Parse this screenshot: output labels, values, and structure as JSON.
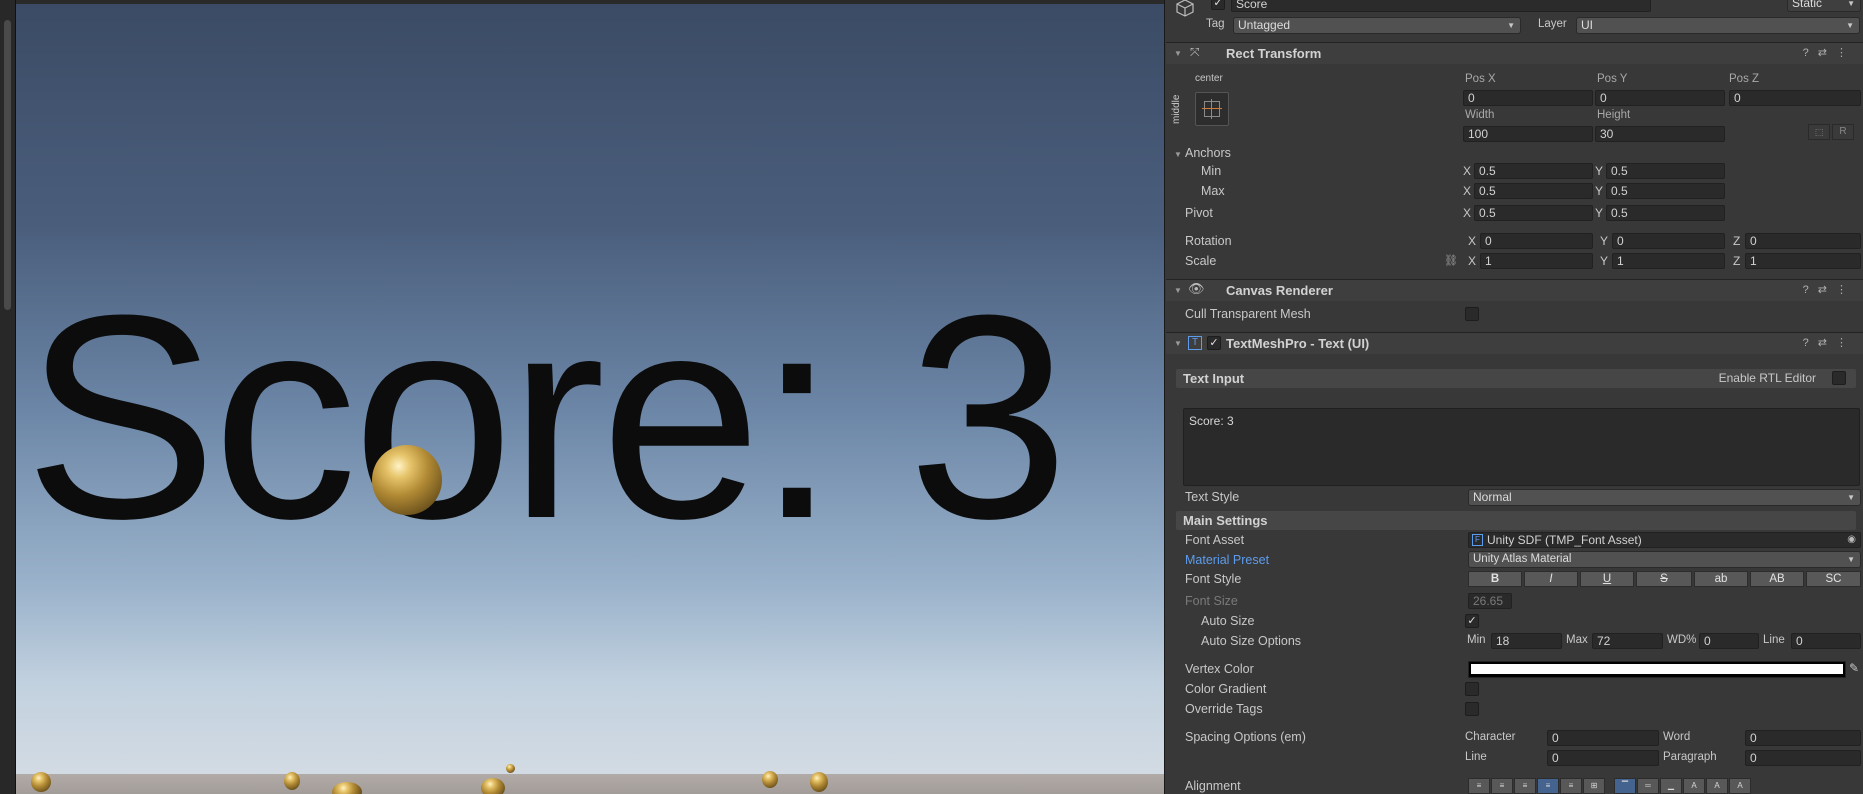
{
  "scene": {
    "score_text": "Score: 3"
  },
  "header": {
    "object_name": "Score",
    "active_checked": true,
    "static_label": "Static",
    "tag_label": "Tag",
    "tag_value": "Untagged",
    "layer_label": "Layer",
    "layer_value": "UI"
  },
  "rect_transform": {
    "title": "Rect Transform",
    "anchor_preset_h": "center",
    "anchor_preset_v": "middle",
    "pos_x_label": "Pos X",
    "pos_x": "0",
    "pos_y_label": "Pos Y",
    "pos_y": "0",
    "pos_z_label": "Pos Z",
    "pos_z": "0",
    "width_label": "Width",
    "width": "100",
    "height_label": "Height",
    "height": "30",
    "raw_label": "R",
    "anchors_label": "Anchors",
    "min_label": "Min",
    "min_x": "0.5",
    "min_y": "0.5",
    "max_label": "Max",
    "max_x": "0.5",
    "max_y": "0.5",
    "pivot_label": "Pivot",
    "pivot_x": "0.5",
    "pivot_y": "0.5",
    "rotation_label": "Rotation",
    "rot_x": "0",
    "rot_y": "0",
    "rot_z": "0",
    "scale_label": "Scale",
    "scale_x": "1",
    "scale_y": "1",
    "scale_z": "1",
    "axis_x": "X",
    "axis_y": "Y",
    "axis_z": "Z"
  },
  "canvas_renderer": {
    "title": "Canvas Renderer",
    "cull_label": "Cull Transparent Mesh",
    "cull_checked": false
  },
  "tmp": {
    "title": "TextMeshPro - Text (UI)",
    "enabled": true,
    "text_input_label": "Text Input",
    "rtl_label": "Enable RTL Editor",
    "text_value": "Score: 3",
    "text_style_label": "Text Style",
    "text_style_value": "Normal",
    "main_settings_label": "Main Settings",
    "font_asset_label": "Font Asset",
    "font_asset_value": "Unity SDF (TMP_Font Asset)",
    "material_preset_label": "Material Preset",
    "material_preset_value": "Unity Atlas Material",
    "font_style_label": "Font Style",
    "font_style_buttons": [
      "B",
      "I",
      "U",
      "S",
      "ab",
      "AB",
      "SC"
    ],
    "font_size_label": "Font Size",
    "font_size_value": "26.65",
    "auto_size_label": "Auto Size",
    "auto_size_checked": true,
    "auto_size_options_label": "Auto Size Options",
    "min_label": "Min",
    "min_value": "18",
    "max_label": "Max",
    "max_value": "72",
    "wd_label": "WD%",
    "wd_value": "0",
    "line_label": "Line",
    "line_value": "0",
    "vertex_color_label": "Vertex Color",
    "vertex_color": "#ffffff",
    "color_gradient_label": "Color Gradient",
    "override_tags_label": "Override Tags",
    "spacing_label": "Spacing Options (em)",
    "character_label": "Character",
    "character_value": "0",
    "word_label": "Word",
    "word_value": "0",
    "spacing_line_label": "Line",
    "spacing_line_value": "0",
    "paragraph_label": "Paragraph",
    "paragraph_value": "0",
    "alignment_label": "Alignment"
  },
  "colors": {
    "link_blue": "#5d9cec",
    "active_align": "#45638f"
  }
}
